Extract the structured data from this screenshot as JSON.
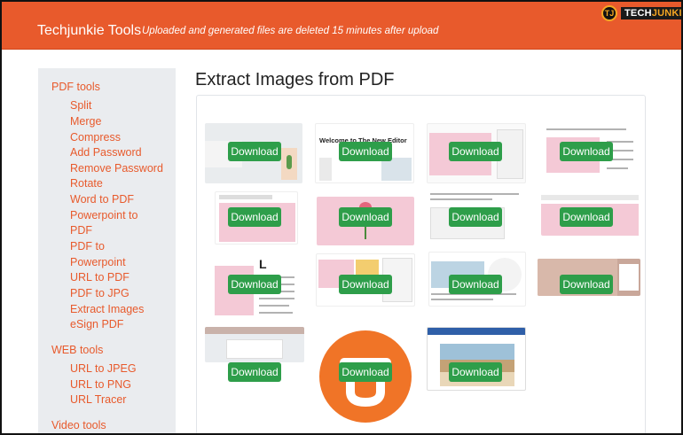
{
  "header": {
    "brand": "Techjunkie Tools",
    "tagline": "Uploaded and generated files are deleted 15 minutes after upload"
  },
  "watermark": {
    "prefix": "TJ",
    "text_a": "TECH",
    "text_b": "JUNKIE"
  },
  "sidebar": {
    "pdf_section": "PDF tools",
    "pdf_items": [
      "Split",
      "Merge",
      "Compress",
      "Add Password",
      "Remove Password",
      "Rotate",
      "Word to PDF",
      "Powerpoint to",
      "PDF",
      "PDF to",
      "Powerpoint",
      "URL to PDF",
      "PDF to JPG",
      "Extract Images",
      "eSign PDF"
    ],
    "web_section": "WEB tools",
    "web_items": [
      "URL to JPEG",
      "URL to PNG",
      "URL Tracer"
    ],
    "video_section": "Video tools"
  },
  "main": {
    "title": "Extract Images from PDF",
    "download_label": "Download",
    "thumb_texts": {
      "t2_heading": "Welcome to The New Editor"
    }
  },
  "colors": {
    "accent": "#e85a2c",
    "button": "#2e9e4a",
    "sidebar_bg": "#eaecef"
  }
}
